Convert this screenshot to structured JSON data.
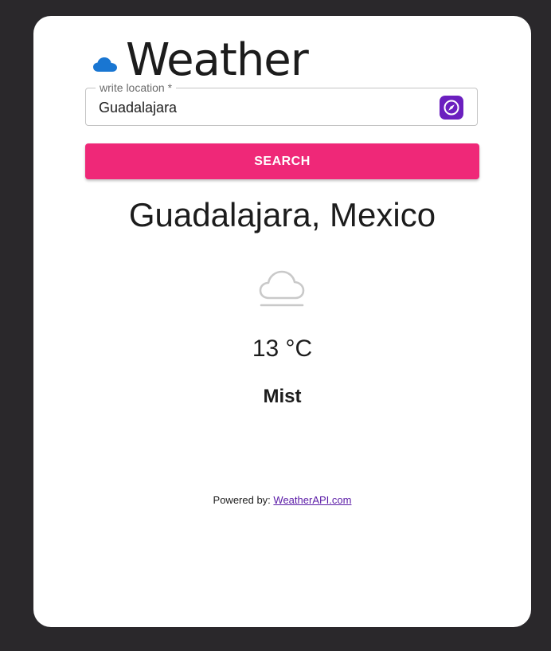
{
  "app": {
    "title": "Weather",
    "logo_icon": "cloud-icon"
  },
  "search": {
    "label": "write location *",
    "value": "Guadalajara",
    "locate_icon": "compass-icon",
    "button_label": "SEARCH"
  },
  "result": {
    "location": "Guadalajara, Mexico",
    "condition_icon": "mist-cloud-icon",
    "temperature": "13 °C",
    "condition": "Mist"
  },
  "footer": {
    "powered_by": "Powered by:",
    "link_text": "WeatherAPI.com"
  },
  "colors": {
    "background": "#2a282b",
    "card": "#ffffff",
    "accent": "#ef2878",
    "logo": "#1976d2",
    "compass": "#6b1fbf"
  }
}
